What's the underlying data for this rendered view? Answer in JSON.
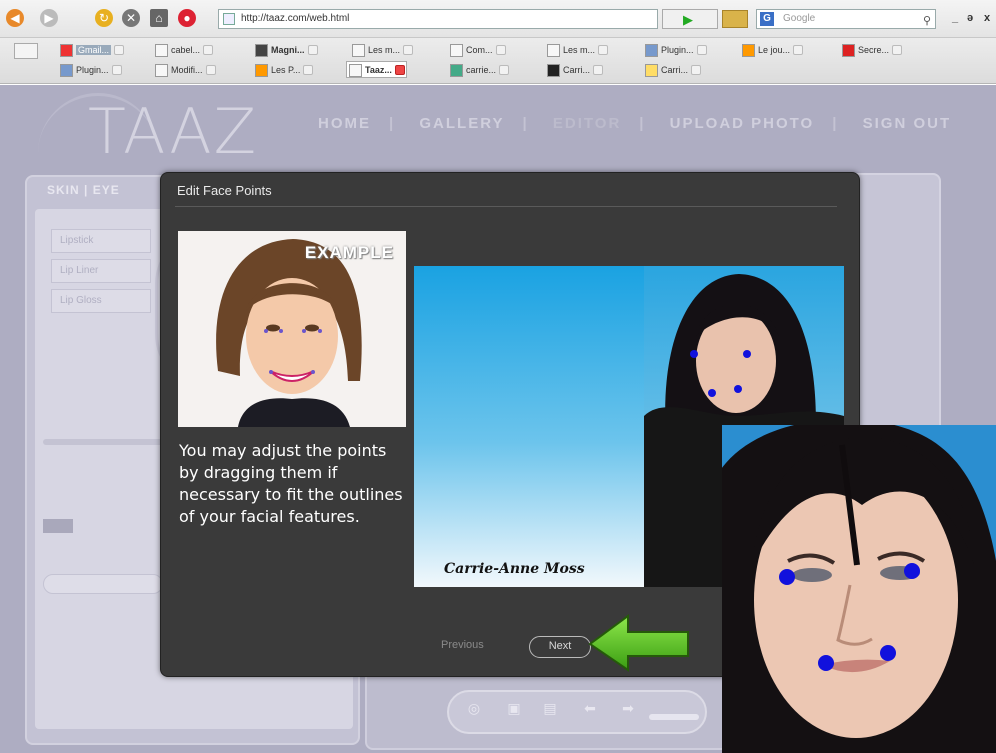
{
  "browser": {
    "url": "http://taaz.com/web.html",
    "search_placeholder": "Google",
    "window_controls": [
      "_",
      "ə",
      "x"
    ]
  },
  "bookmarks_row1": [
    {
      "label": "Gmail...",
      "active": false
    },
    {
      "label": "cabel...",
      "active": false
    },
    {
      "label": "Magni...",
      "active": false
    },
    {
      "label": "Les m...",
      "active": false
    },
    {
      "label": "Com...",
      "active": false
    },
    {
      "label": "Les m...",
      "active": false
    },
    {
      "label": "Plugin...",
      "active": false
    },
    {
      "label": "Le jou...",
      "active": false
    },
    {
      "label": "Secre...",
      "active": false
    }
  ],
  "bookmarks_row2": [
    {
      "label": "Plugin...",
      "active": false
    },
    {
      "label": "Modifi...",
      "active": false
    },
    {
      "label": "Les P...",
      "active": false
    },
    {
      "label": "Taaz...",
      "active": true
    },
    {
      "label": "carrie...",
      "active": false
    },
    {
      "label": "Carri...",
      "active": false
    },
    {
      "label": "Carri...",
      "active": false
    }
  ],
  "site": {
    "logo": "TAAZ",
    "nav": [
      "HOME",
      "GALLERY",
      "EDITOR",
      "UPLOAD PHOTO",
      "SIGN OUT"
    ],
    "left_tabs": "SKIN | EYE",
    "left_buttons": [
      "Lipstick",
      "Lip Liner",
      "Lip Gloss"
    ]
  },
  "modal": {
    "title": "Edit Face Points",
    "example_label": "EXAMPLE",
    "instructions": "You may adjust the points by dragging them if necessary to fit the outlines of your facial features.",
    "photo_caption": "Carrie-Anne Moss",
    "previous_label": "Previous",
    "next_label": "Next"
  },
  "colors": {
    "accent_point": "#1111dd",
    "arrow": "#5fc81f",
    "modal_bg": "#3a3a3a",
    "page_bg": "#aeadc2"
  }
}
